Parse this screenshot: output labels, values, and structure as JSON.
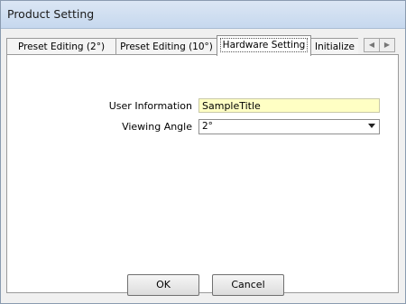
{
  "window": {
    "title": "Product Setting"
  },
  "tabs": [
    {
      "label": "Preset Editing (2°)"
    },
    {
      "label": "Preset Editing (10°)"
    },
    {
      "label": "Hardware Setting"
    },
    {
      "label": "Initialize"
    }
  ],
  "tab_scroll": {
    "left_icon": "◀",
    "right_icon": "▶"
  },
  "form": {
    "user_info_label": "User Information",
    "user_info_value": "SampleTitle",
    "viewing_angle_label": "Viewing Angle",
    "viewing_angle_value": "2°"
  },
  "buttons": {
    "ok": "OK",
    "cancel": "Cancel"
  }
}
